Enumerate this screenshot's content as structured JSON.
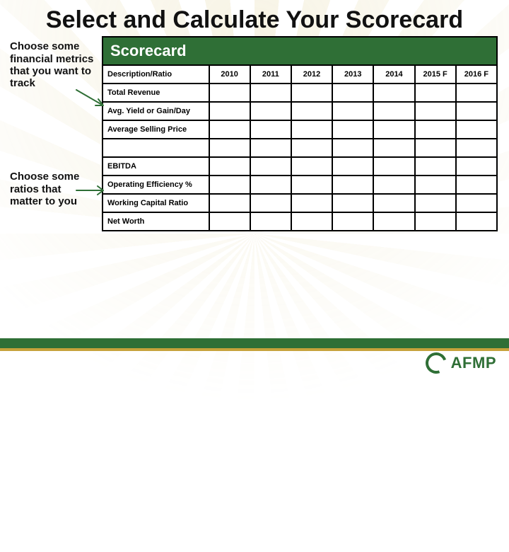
{
  "title": "Select and Calculate Your Scorecard",
  "side": {
    "note1": "Choose some financial metrics that you want to track",
    "note2": "Choose some ratios that matter to you"
  },
  "table": {
    "heading": "Scorecard",
    "header": {
      "desc": "Description/Ratio",
      "y2010": "2010",
      "y2011": "2011",
      "y2012": "2012",
      "y2013": "2013",
      "y2014": "2014",
      "y2015f": "2015 F",
      "y2016f": "2016 F"
    },
    "rows": [
      "Total Revenue",
      "Avg. Yield or Gain/Day",
      "Average Selling Price",
      "",
      "EBITDA",
      "Operating Efficiency %",
      "Working Capital Ratio",
      "Net Worth"
    ]
  },
  "logo": "AFMP"
}
